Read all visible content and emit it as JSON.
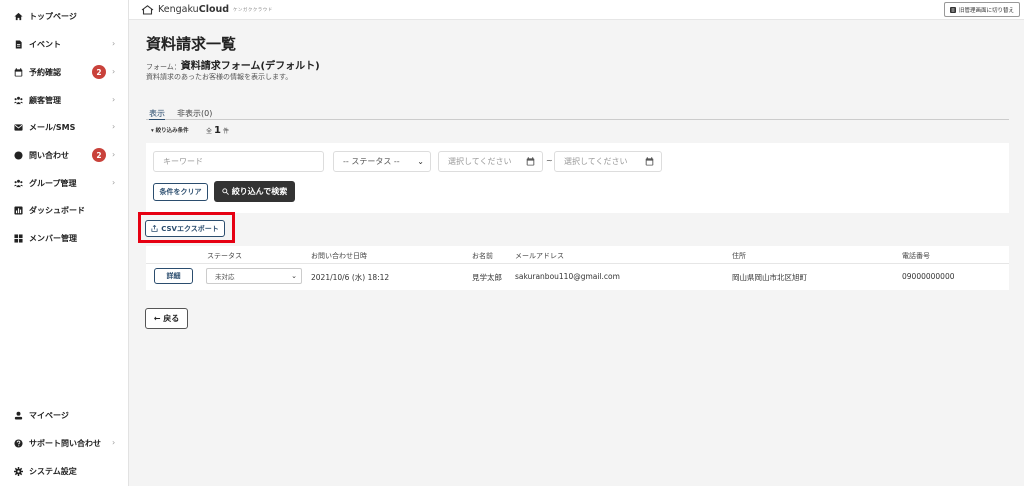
{
  "sidebar": {
    "items": [
      {
        "label": "トップページ",
        "icon": "home-icon",
        "chevron": ""
      },
      {
        "label": "イベント",
        "icon": "document-icon",
        "chevron": "›"
      },
      {
        "label": "予約確認",
        "icon": "calendar-icon",
        "badge": "2",
        "chevron": "›"
      },
      {
        "label": "顧客管理",
        "icon": "users-icon",
        "chevron": "›"
      },
      {
        "label": "メール/SMS",
        "icon": "mail-icon",
        "chevron": "›"
      },
      {
        "label": "問い合わせ",
        "icon": "inquiry-icon",
        "badge": "2",
        "chevron": "›"
      },
      {
        "label": "グループ管理",
        "icon": "group-icon",
        "chevron": "›"
      },
      {
        "label": "ダッシュボード",
        "icon": "dashboard-icon",
        "chevron": ""
      },
      {
        "label": "メンバー管理",
        "icon": "grid-icon",
        "chevron": ""
      }
    ],
    "bottom": [
      {
        "label": "マイページ",
        "icon": "person-icon",
        "chevron": ""
      },
      {
        "label": "サポート問い合わせ",
        "icon": "help-icon",
        "chevron": "›"
      },
      {
        "label": "システム設定",
        "icon": "gear-icon",
        "chevron": ""
      }
    ]
  },
  "header": {
    "logo_text_a": "Kengaku",
    "logo_text_b": "Cloud",
    "logo_sub": "ケンガククラウド",
    "switch_label": "旧管理画面に切り替え"
  },
  "page": {
    "title": "資料請求一覧",
    "form_prefix": "フォーム：",
    "form_name": "資料請求フォーム(デフォルト)",
    "description": "資料請求のあったお客様の情報を表示します。"
  },
  "tabs": {
    "active": "表示",
    "hidden": "非表示(0)"
  },
  "filter": {
    "label": "▾ 絞り込み条件",
    "total_prefix": "全",
    "total_count": "1",
    "total_suffix": "件",
    "keyword_placeholder": "キーワード",
    "status_selected": "-- ステータス --",
    "date_from_placeholder": "選択してください",
    "date_to_placeholder": "選択してください",
    "tilde": "~",
    "clear_label": "条件をクリア",
    "search_label": "絞り込んで検索"
  },
  "csv_label": "CSVエクスポート",
  "table": {
    "headers": {
      "status": "ステータス",
      "datetime": "お問い合わせ日時",
      "name": "お名前",
      "email": "メールアドレス",
      "address": "住所",
      "phone": "電話番号"
    },
    "rows": [
      {
        "detail_label": "詳細",
        "status": "未対応",
        "datetime": "2021/10/6 (水) 18:12",
        "name": "見学太郎",
        "email": "sakuranbou110@gmail.com",
        "address": "岡山県岡山市北区旭町",
        "phone": "09000000000"
      }
    ]
  },
  "back_label": "← 戻る",
  "colors": {
    "accent": "#2b4d6e",
    "badge": "#c9423b",
    "highlight": "#e60012",
    "dark_button": "#333333"
  }
}
